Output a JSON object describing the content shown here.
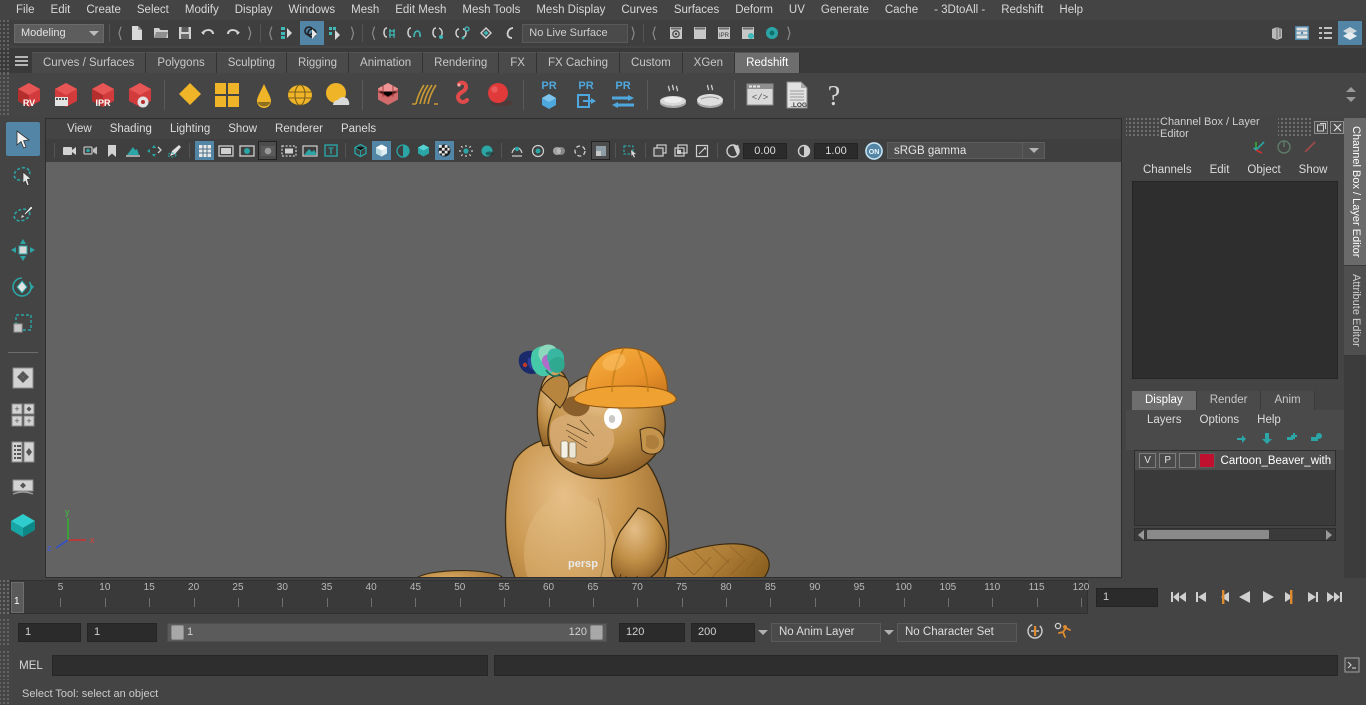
{
  "menubar": {
    "items": [
      "File",
      "Edit",
      "Create",
      "Select",
      "Modify",
      "Display",
      "Windows",
      "Mesh",
      "Edit Mesh",
      "Mesh Tools",
      "Mesh Display",
      "Curves",
      "Surfaces",
      "Deform",
      "UV",
      "Generate",
      "Cache",
      "- 3DtoAll -",
      "Redshift",
      "Help"
    ]
  },
  "statusline": {
    "menu_set": "Modeling",
    "live_surface": "No Live Surface",
    "icons": {
      "new_scene": "new-scene-icon",
      "open_scene": "open-scene-icon",
      "save_scene": "save-scene-icon",
      "undo": "undo-icon",
      "redo": "redo-icon",
      "select_hierarchy": "select-by-hierarchy-icon",
      "select_object": "select-by-object-icon",
      "select_component": "select-by-component-icon",
      "snap_grid": "snap-to-grid-icon",
      "snap_curve": "snap-to-curve-icon",
      "snap_point": "snap-to-point-icon",
      "snap_projected": "snap-to-projected-center-icon",
      "snap_view_plane": "snap-to-view-plane-icon",
      "make_live": "make-live-icon",
      "render_current": "render-current-frame-icon",
      "render_settings": "render-settings-icon",
      "ipr_render": "ipr-render-icon",
      "render_setup": "render-setup-icon",
      "render_view": "hypershade-icon",
      "toggle_outliner": "toggle-outliner-icon",
      "toggle_attribute_editor": "toggle-attribute-editor-icon",
      "toggle_tool_settings": "toggle-tool-settings-icon",
      "toggle_channel_box": "toggle-channel-box-icon"
    }
  },
  "shelf": {
    "tabs": [
      "Curves / Surfaces",
      "Polygons",
      "Sculpting",
      "Rigging",
      "Animation",
      "Rendering",
      "FX",
      "FX Caching",
      "Custom",
      "XGen",
      "Redshift"
    ],
    "selected_tab": "Redshift",
    "buttons": [
      {
        "name": "redshift-rv-button",
        "label": "RV"
      },
      {
        "name": "redshift-render-sequence-button",
        "label": ""
      },
      {
        "name": "redshift-ipr-button",
        "label": "IPR"
      },
      {
        "name": "redshift-render-options-button",
        "label": ""
      },
      {
        "name": "redshift-material-button",
        "label": ""
      },
      {
        "name": "redshift-texture-button",
        "label": ""
      },
      {
        "name": "redshift-light-dome-button",
        "label": ""
      },
      {
        "name": "redshift-environment-button",
        "label": ""
      },
      {
        "name": "redshift-sky-button",
        "label": ""
      },
      {
        "name": "redshift-proxy-button",
        "label": ""
      },
      {
        "name": "redshift-hair-button",
        "label": ""
      },
      {
        "name": "redshift-volume-button",
        "label": ""
      },
      {
        "name": "redshift-sphere-button",
        "label": ""
      },
      {
        "name": "redshift-pr-object-button",
        "label": "PR"
      },
      {
        "name": "redshift-pr-export-button",
        "label": "PR"
      },
      {
        "name": "redshift-pr-transfer-button",
        "label": "PR"
      },
      {
        "name": "redshift-bake-button",
        "label": ""
      },
      {
        "name": "redshift-bake-set-button",
        "label": ""
      },
      {
        "name": "redshift-script-button",
        "label": ""
      },
      {
        "name": "redshift-log-button",
        "label": ".LOG"
      },
      {
        "name": "redshift-help-button",
        "label": "?"
      }
    ]
  },
  "toolbox": {
    "items": [
      {
        "name": "select-tool",
        "selected": true
      },
      {
        "name": "lasso-select-tool",
        "selected": false
      },
      {
        "name": "paint-select-tool",
        "selected": false
      },
      {
        "name": "move-tool",
        "selected": false
      },
      {
        "name": "rotate-tool",
        "selected": false
      },
      {
        "name": "scale-tool",
        "selected": false
      },
      {
        "name": "last-tool-used",
        "selected": false
      },
      {
        "name": "four-view-layout",
        "selected": false
      },
      {
        "name": "outliner-persp-layout",
        "selected": false
      },
      {
        "name": "hypergraph-persp-layout",
        "selected": false
      },
      {
        "name": "persp-layout",
        "selected": false
      },
      {
        "name": "workspace-icon",
        "selected": false
      }
    ]
  },
  "viewport": {
    "menus": [
      "View",
      "Shading",
      "Lighting",
      "Show",
      "Renderer",
      "Panels"
    ],
    "camera_label": "persp",
    "exposure": "0.00",
    "gamma": "1.00",
    "color_management": "sRGB gamma",
    "toolbar_icons": [
      "select-camera-icon",
      "camera-attributes-icon",
      "bookmark-icon",
      "image-plane-icon",
      "two-d-pan-zoom-icon",
      "grease-pencil-icon",
      "grid-toggle-icon",
      "film-gate-icon",
      "resolution-gate-icon",
      "gate-mask-icon",
      "film-origin-icon",
      "exposure-icon",
      "text-overlay-icon",
      "wireframe-icon",
      "smooth-shade-all-icon",
      "shaded-wireframe-icon",
      "textured-icon",
      "use-all-lights-icon",
      "shadows-icon",
      "ambient-occlusion-icon",
      "motion-blur-icon",
      "multisample-icon",
      "xray-icon",
      "xray-joints-icon",
      "xray-active-components-icon",
      "isolate-select-icon",
      "display-layers-icon",
      "no-depth-icon",
      "panel-zoom-icon",
      "exposure-reset-icon",
      "gamma-reset-icon",
      "color-management-toggle-icon"
    ],
    "axis_labels": {
      "x": "x",
      "y": "y",
      "z": "z"
    }
  },
  "right_panel": {
    "title": "Channel Box / Layer Editor",
    "window_buttons": [
      "undock-icon",
      "close-icon"
    ],
    "channel_menus": [
      "Channels",
      "Edit",
      "Object",
      "Show"
    ],
    "header_icons": [
      "manipulator-axis-icon",
      "non-keyable-icon",
      "slider-icon"
    ],
    "layer_editor": {
      "tabs": [
        "Display",
        "Render",
        "Anim"
      ],
      "selected_tab": "Display",
      "menus": [
        "Layers",
        "Options",
        "Help"
      ],
      "tool_icons": [
        "move-layer-up-icon",
        "move-layer-down-icon",
        "new-layer-icon",
        "new-layer-from-selected-icon"
      ],
      "layers": [
        {
          "visibility": "V",
          "playback": "P",
          "type": "",
          "color": "#c01030",
          "name": "Cartoon_Beaver_with_"
        }
      ]
    },
    "side_tabs": [
      "Channel Box / Layer Editor",
      "Attribute Editor"
    ],
    "selected_side_tab": "Channel Box / Layer Editor"
  },
  "timeline": {
    "ticks": [
      5,
      10,
      15,
      20,
      25,
      30,
      35,
      40,
      45,
      50,
      55,
      60,
      65,
      70,
      75,
      80,
      85,
      90,
      95,
      100,
      105,
      110,
      115,
      120
    ],
    "current_frame_marker": "1",
    "current_frame_field": "1",
    "transport": [
      "go-to-start-icon",
      "step-back-keyframe-icon",
      "step-back-frame-icon",
      "play-backwards-icon",
      "play-forwards-icon",
      "step-forward-frame-icon",
      "step-forward-keyframe-icon",
      "go-to-end-icon"
    ]
  },
  "range": {
    "anim_start": "1",
    "range_start": "1",
    "slider_start_label": "1",
    "slider_end_label": "120",
    "range_end": "120",
    "anim_end": "200",
    "anim_layer": "No Anim Layer",
    "character_set": "No Character Set",
    "icons": [
      "auto-keyframe-icon",
      "animation-preferences-icon"
    ]
  },
  "command_line": {
    "label": "MEL",
    "input_value": "",
    "output_value": "",
    "expand_icon": "expand-script-editor-icon"
  },
  "help_line": {
    "text": "Select Tool: select an object"
  },
  "colors": {
    "accent_blue": "#5285a6",
    "teal": "#2ba5a5",
    "orange": "#e5973b",
    "viewport_bg": "#636363",
    "panel_bg": "#444444",
    "layer_red": "#c01030"
  }
}
